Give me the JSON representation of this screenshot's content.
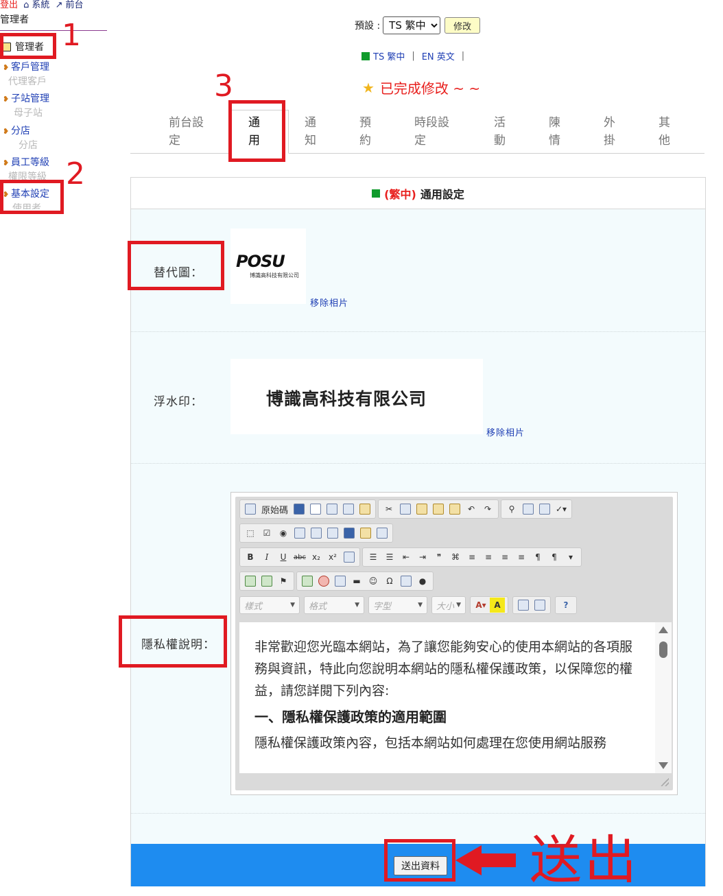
{
  "topnav": {
    "logout": "登出",
    "system": "系統",
    "frontend": "前台"
  },
  "sidebar": {
    "role": "管理者",
    "section": "管理者",
    "items": [
      {
        "label": "客戶管理",
        "sub": "代理客戶"
      },
      {
        "label": "子站管理",
        "sub": "母子站"
      },
      {
        "label": "分店",
        "sub": "分店"
      },
      {
        "label": "員工等級",
        "sub": "權限等級"
      },
      {
        "label": "基本設定",
        "sub": "使用者"
      }
    ]
  },
  "annotations": {
    "n1": "1",
    "n2": "2",
    "n3": "3",
    "send": "送出"
  },
  "lang": {
    "label": "預設 :",
    "selected": "TS 繁中",
    "modify": "修改",
    "links": [
      "TS 繁中",
      "EN 英文"
    ]
  },
  "status": {
    "message": "已完成修改 ~ ~"
  },
  "tabs": [
    {
      "label": "前台設定"
    },
    {
      "label": "通用"
    },
    {
      "label": "通知"
    },
    {
      "label": "預約"
    },
    {
      "label": "時段設定"
    },
    {
      "label": "活動"
    },
    {
      "label": "陳情"
    },
    {
      "label": "外掛"
    },
    {
      "label": "其他"
    }
  ],
  "panel": {
    "tag": "(繁中)",
    "title": "通用設定",
    "alt_image_label": "替代圖：",
    "logo_brand": "POSU",
    "logo_company": "博識高科技有限公司",
    "watermark_label": "浮水印：",
    "watermark_text": "博識高科技有限公司",
    "remove_photo": "移除相片",
    "privacy_label": "隱私權說明：",
    "submit": "送出資料"
  },
  "editor": {
    "source": "原始碼",
    "combos": [
      "樣式",
      "格式",
      "字型",
      "大小"
    ],
    "content": {
      "intro": "非常歡迎您光臨本網站，為了讓您能夠安心的使用本網站的各項服務與資訊，特此向您說明本網站的隱私權保護政策，以保障您的權益，請您詳閱下列內容:",
      "heading": "一、隱私權保護政策的適用範圍",
      "body": "隱私權保護政策內容，包括本網站如何處理在您使用網站服務"
    }
  },
  "colors": {
    "accent_red": "#e01a22",
    "submit_bar": "#1e8cf0",
    "link": "#1f3fb4",
    "panel_bg": "#f3fbfd"
  }
}
